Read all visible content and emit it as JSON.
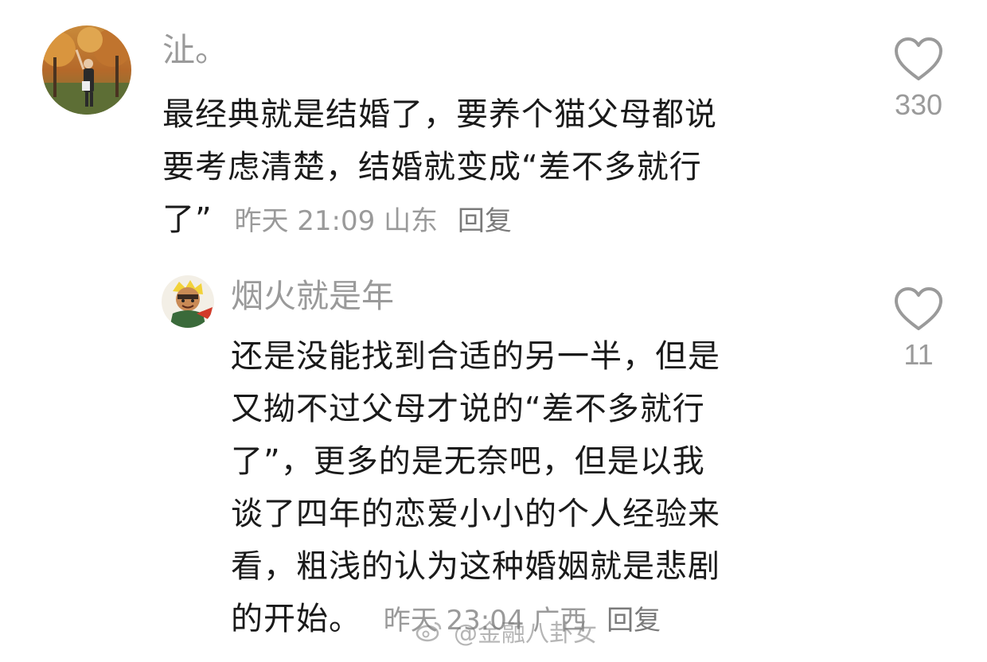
{
  "comments": [
    {
      "username": "沚。",
      "avatar_icon": "user-photo-autumn-avatar",
      "lines": [
        "最经典就是结婚了，要养个猫父母都说",
        "要考虑清楚，结婚就变成“差不多就行",
        "了”"
      ],
      "time": "昨天 21:09",
      "location": "山东",
      "reply_label": "回复",
      "likes": "330"
    },
    {
      "username": "烟火就是年",
      "avatar_icon": "cartoon-character-avatar",
      "lines": [
        "还是没能找到合适的另一半，但是",
        "又拗不过父母才说的“差不多就行",
        "了”，更多的是无奈吧，但是以我",
        "谈了四年的恋爱小小的个人经验来",
        "看，粗浅的认为这种婚姻就是悲剧",
        "的开始。"
      ],
      "time": "昨天 23:04",
      "location": "广西",
      "reply_label": "回复",
      "likes": "11"
    }
  ],
  "watermark": {
    "text": "@金融八卦女",
    "icon": "weibo-icon"
  },
  "colors": {
    "text": "#1a1a1a",
    "muted": "#9a9a9a",
    "background": "#ffffff"
  }
}
